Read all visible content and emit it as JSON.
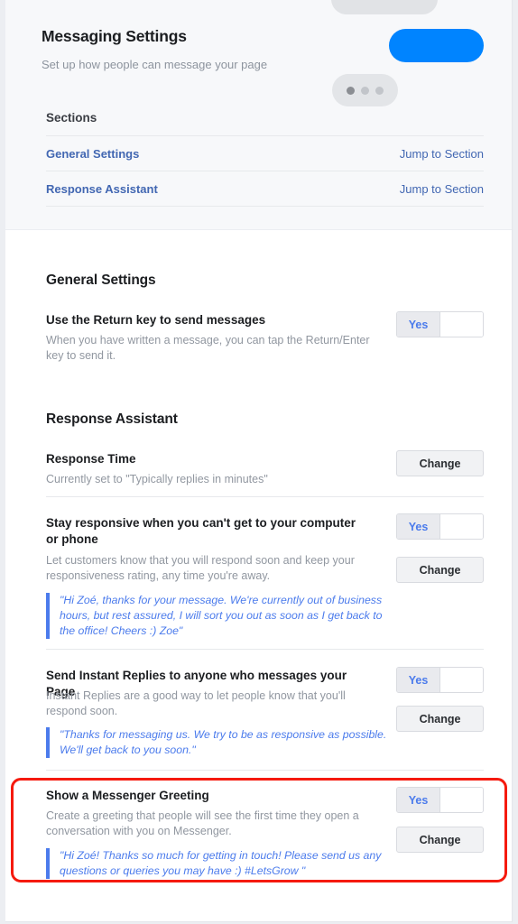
{
  "header": {
    "title": "Messaging Settings",
    "subtitle": "Set up how people can message your page",
    "sections_label": "Sections",
    "sections": [
      {
        "label": "General Settings",
        "action": "Jump to Section"
      },
      {
        "label": "Response Assistant",
        "action": "Jump to Section"
      }
    ],
    "accent_blue": "#0084ff",
    "link_blue": "#4267b2"
  },
  "general_settings": {
    "heading": "General Settings",
    "rows": [
      {
        "title": "Use the Return key to send messages",
        "description": "When you have written a message, you can tap the Return/Enter key to send it.",
        "toggle_value": "Yes"
      }
    ]
  },
  "response_assistant": {
    "heading": "Response Assistant",
    "rows": [
      {
        "title": "Response Time",
        "description": "Currently set to \"Typically replies in minutes\"",
        "button": "Change"
      },
      {
        "title": "Stay responsive when you can't get to your computer or phone",
        "description": "Let customers know that you will respond soon and keep your responsiveness rating, any time you're away.",
        "toggle_value": "Yes",
        "button": "Change",
        "quote": "\"Hi Zoé, thanks for your message. We're currently out of business hours, but rest assured, I will sort you out as soon as I get back to the office! Cheers :) Zoe\""
      },
      {
        "title": "Send Instant Replies to anyone who messages your Page",
        "description": "Instant Replies are a good way to let people know that you'll respond soon.",
        "toggle_value": "Yes",
        "button": "Change",
        "quote": "\"Thanks for messaging us. We try to be as responsive as possible. We'll get back to you soon.\""
      },
      {
        "title": "Show a Messenger Greeting",
        "description": "Create a greeting that people will see the first time they open a conversation with you on Messenger.",
        "toggle_value": "Yes",
        "button": "Change",
        "quote": "\"Hi Zoé! Thanks so much for getting in touch! Please send us any questions or queries you may have :) #LetsGrow \"",
        "highlight_color": "#f51a0e"
      }
    ]
  }
}
